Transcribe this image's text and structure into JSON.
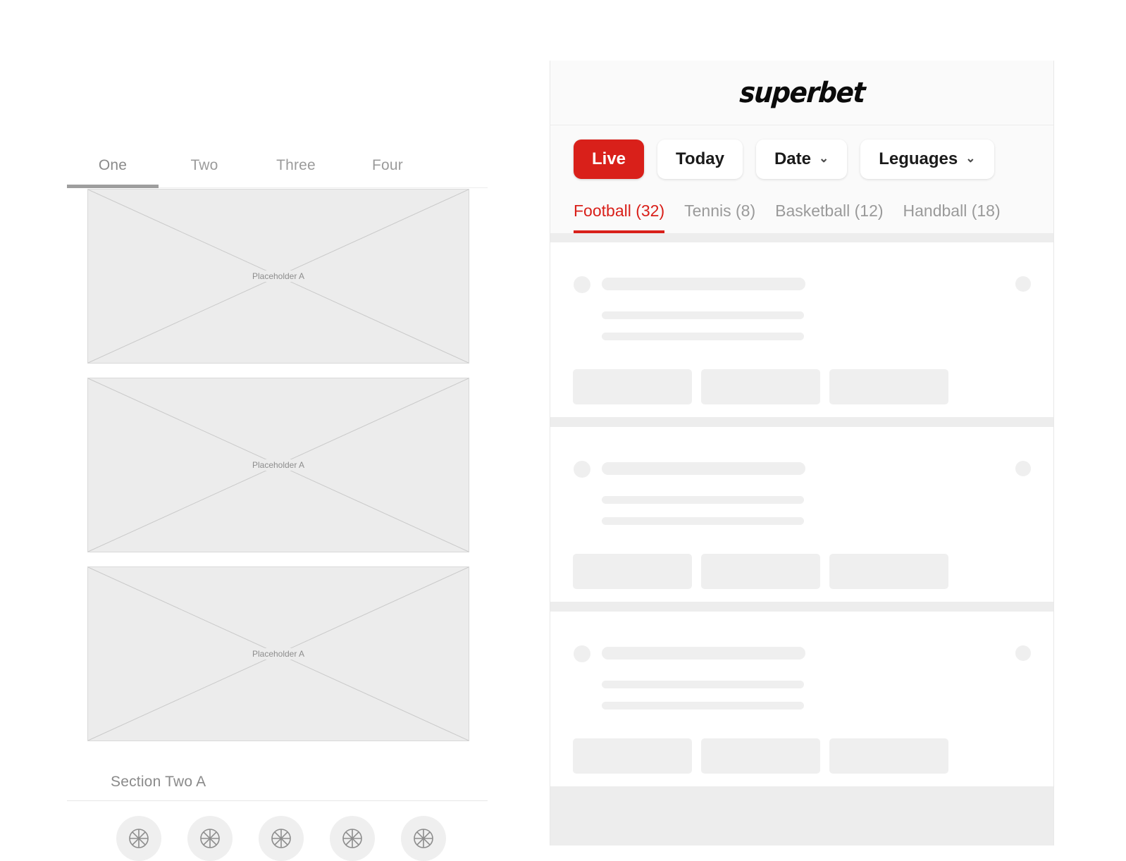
{
  "left_panel": {
    "tabs": [
      {
        "label": "One",
        "active": true
      },
      {
        "label": "Two",
        "active": false
      },
      {
        "label": "Three",
        "active": false
      },
      {
        "label": "Four",
        "active": false
      }
    ],
    "placeholders": [
      {
        "label": "Placeholder A"
      },
      {
        "label": "Placeholder A"
      },
      {
        "label": "Placeholder A"
      }
    ],
    "section_heading": "Section Two A",
    "chips": [
      {
        "icon": "ball-wheel-icon"
      },
      {
        "icon": "ball-wheel-icon"
      },
      {
        "icon": "ball-wheel-icon"
      },
      {
        "icon": "ball-wheel-icon"
      },
      {
        "icon": "ball-wheel-icon"
      }
    ]
  },
  "right_panel": {
    "brand": "superbet",
    "filters": [
      {
        "label": "Live",
        "active": true,
        "has_chevron": false,
        "chevron": ""
      },
      {
        "label": "Today",
        "active": false,
        "has_chevron": false,
        "chevron": ""
      },
      {
        "label": "Date",
        "active": false,
        "has_chevron": true,
        "chevron": "⌄"
      },
      {
        "label": "Leguages",
        "active": false,
        "has_chevron": true,
        "chevron": "⌄"
      }
    ],
    "sport_tabs": [
      {
        "label": "Football (32)",
        "active": true
      },
      {
        "label": "Tennis (8)",
        "active": false
      },
      {
        "label": "Basketball (12)",
        "active": false
      },
      {
        "label": "Handball (18)",
        "active": false
      }
    ],
    "match_cards": [
      {
        "state": "loading-skeleton"
      },
      {
        "state": "loading-skeleton"
      },
      {
        "state": "loading-skeleton"
      }
    ]
  },
  "colors": {
    "brand_red": "#d9201a",
    "skeleton_gray": "#efefef",
    "panel_gap_gray": "#ededed",
    "header_bg": "#fafafa",
    "muted_text": "#9a9a9a"
  }
}
